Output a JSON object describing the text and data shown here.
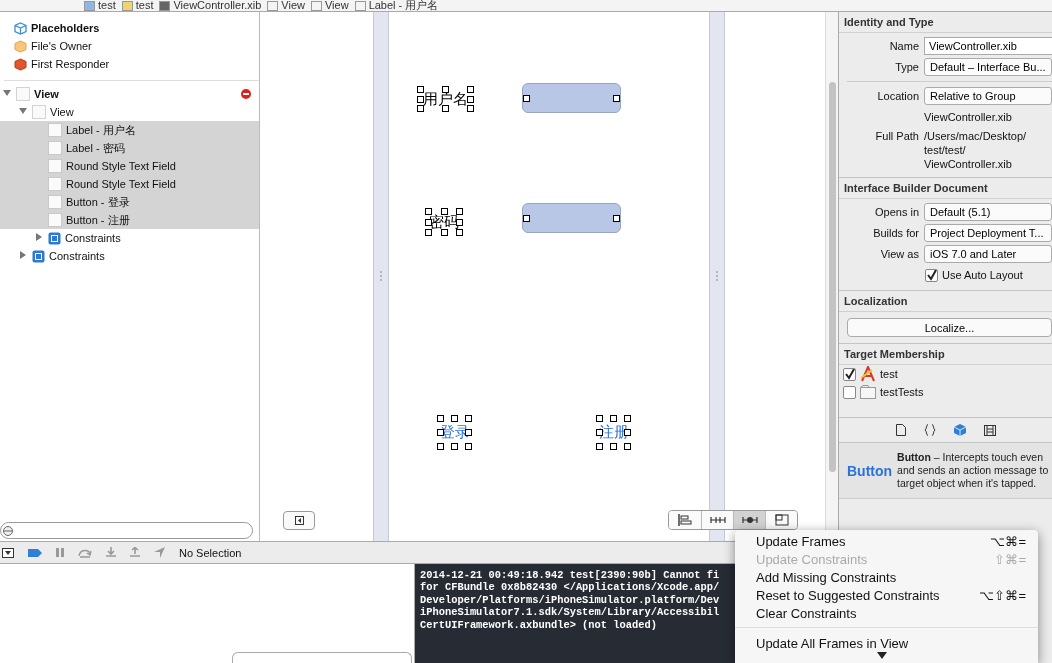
{
  "breadcrumb": [
    {
      "label": "test",
      "kind": "project"
    },
    {
      "label": "test",
      "kind": "folder"
    },
    {
      "label": "ViewController.xib",
      "kind": "xib"
    },
    {
      "label": "View",
      "kind": "view"
    },
    {
      "label": "View",
      "kind": "view"
    },
    {
      "label": "Label - 用户名",
      "kind": "view"
    }
  ],
  "outline": [
    {
      "label": "Placeholders",
      "kind": "header"
    },
    {
      "label": "File's Owner",
      "kind": "owner"
    },
    {
      "label": "First Responder",
      "kind": "responder"
    },
    {
      "label": "View",
      "kind": "root",
      "expanded": true,
      "warning": true,
      "children": [
        {
          "label": "View",
          "kind": "view",
          "expanded": true,
          "children": [
            {
              "label": "Label - 用户名",
              "kind": "view",
              "selected": true
            },
            {
              "label": "Label - 密码",
              "kind": "view",
              "selected": true
            },
            {
              "label": "Round Style Text Field",
              "kind": "view",
              "selected": true
            },
            {
              "label": "Round Style Text Field",
              "kind": "view",
              "selected": true
            },
            {
              "label": "Button - 登录",
              "kind": "view",
              "selected": true
            },
            {
              "label": "Button - 注册",
              "kind": "view",
              "selected": true
            },
            {
              "label": "Constraints",
              "kind": "constraints",
              "expanded": false,
              "selected": false
            }
          ]
        },
        {
          "label": "Constraints",
          "kind": "constraints",
          "expanded": false
        }
      ]
    }
  ],
  "canvas": {
    "elements": [
      {
        "kind": "label",
        "text": "用户名",
        "selected": true
      },
      {
        "kind": "text_field",
        "selected": true
      },
      {
        "kind": "label",
        "text": "密码",
        "selected": true
      },
      {
        "kind": "text_field",
        "selected": true
      },
      {
        "kind": "button",
        "text": "登录",
        "selected": true
      },
      {
        "kind": "button",
        "text": "注册",
        "selected": true
      }
    ],
    "toolbar": [
      {
        "kind": "align",
        "selected": false
      },
      {
        "kind": "pin",
        "selected": false
      },
      {
        "kind": "resolve",
        "selected": true
      },
      {
        "kind": "resize",
        "selected": false
      }
    ]
  },
  "debug_bar": {
    "status": "No Selection"
  },
  "console": {
    "lines": [
      "2014-12-21 00:49:18.942 test[2390:90b] Cannot fi",
      "for CFBundle 0x8b82430 </Applications/Xcode.app/",
      "Developer/Platforms/iPhoneSimulator.platform/Dev",
      "iPhoneSimulator7.1.sdk/System/Library/Accessibil",
      "CertUIFramework.axbundle> (not loaded)"
    ]
  },
  "inspector": {
    "identity": {
      "title": "Identity and Type",
      "rows": [
        {
          "label": "Name",
          "kind": "text",
          "value": "ViewController.xib"
        },
        {
          "label": "Type",
          "kind": "popup",
          "value": "Default – Interface Bu..."
        },
        {
          "kind": "divider"
        },
        {
          "label": "Location",
          "kind": "popup",
          "value": "Relative to Group"
        },
        {
          "kind": "plain",
          "value": "ViewController.xib"
        },
        {
          "label": "Full Path",
          "kind": "plain",
          "value": "/Users/mac/Desktop/\ntest/test/\nViewController.xib"
        }
      ]
    },
    "document": {
      "title": "Interface Builder Document",
      "rows": [
        {
          "label": "Opens in",
          "kind": "popup",
          "value": "Default (5.1)"
        },
        {
          "label": "Builds for",
          "kind": "popup",
          "value": "Project Deployment T..."
        },
        {
          "label": "View as",
          "kind": "popup",
          "value": "iOS 7.0 and Later"
        }
      ],
      "auto_layout": {
        "label": "Use Auto Layout",
        "checked": true
      }
    },
    "localization": {
      "title": "Localization",
      "button": "Localize..."
    },
    "membership": {
      "title": "Target Membership",
      "targets": [
        {
          "name": "test",
          "kind": "app",
          "checked": true
        },
        {
          "name": "testTests",
          "kind": "bundle",
          "checked": false
        }
      ]
    },
    "library_tabs": [
      {
        "kind": "file",
        "selected": false
      },
      {
        "kind": "code",
        "selected": false
      },
      {
        "kind": "object",
        "selected": true
      },
      {
        "kind": "media",
        "selected": false
      }
    ],
    "library_item": {
      "title": "Button",
      "description": "**Button** – Intercepts touch even\nand sends an action message to\ntarget object when it's tapped."
    }
  },
  "menu": {
    "items": [
      {
        "label": "Update Frames",
        "shortcut": "⌥⌘=",
        "disabled": false
      },
      {
        "label": "Update Constraints",
        "shortcut": "⇧⌘=",
        "disabled": true
      },
      {
        "label": "Add Missing Constraints",
        "disabled": false
      },
      {
        "label": "Reset to Suggested Constraints",
        "shortcut": "⌥⇧⌘=",
        "disabled": false
      },
      {
        "label": "Clear Constraints",
        "disabled": false
      },
      {
        "kind": "separator"
      },
      {
        "label": "Update All Frames in View",
        "disabled": false
      }
    ]
  }
}
